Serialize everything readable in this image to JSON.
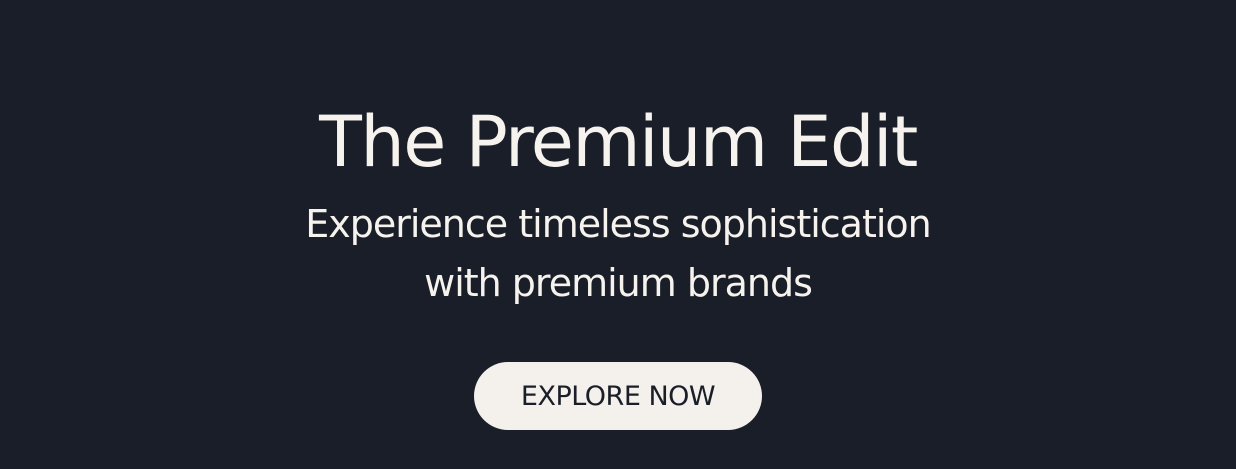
{
  "banner": {
    "title": "The Premium Edit",
    "subtitle_line1": "Experience timeless sophistication",
    "subtitle_line2": "with premium brands",
    "cta_label": "EXPLORE NOW",
    "colors": {
      "background": "#1a1e28",
      "text": "#f6f2ee",
      "button_bg": "#f4f0ec",
      "button_text": "#1a1e28"
    }
  }
}
